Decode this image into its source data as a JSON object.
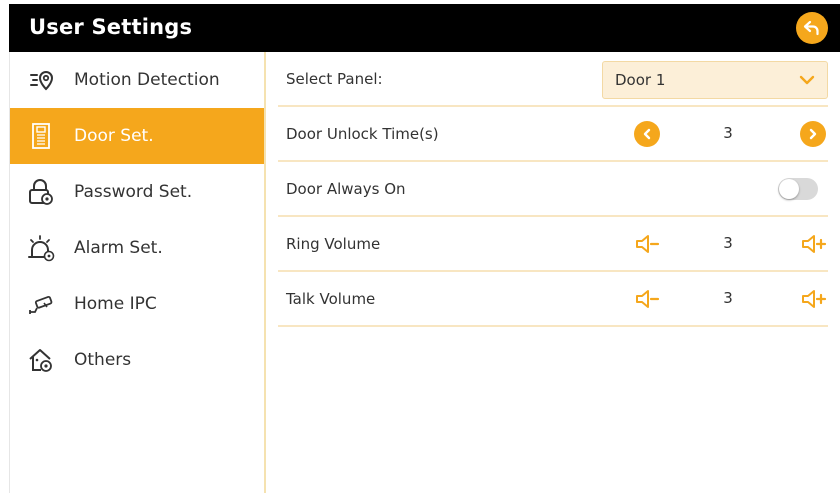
{
  "header": {
    "title": "User Settings",
    "back_icon": "back-arrow-icon"
  },
  "colors": {
    "accent": "#F5A71C",
    "header_bg": "#000000",
    "select_bg": "#FCEFD8",
    "divider": "#F8E6C2"
  },
  "sidebar": {
    "items": [
      {
        "label": "Motion Detection",
        "icon": "motion-detection-icon",
        "active": false
      },
      {
        "label": "Door Set.",
        "icon": "door-icon",
        "active": true
      },
      {
        "label": "Password Set.",
        "icon": "password-lock-icon",
        "active": false
      },
      {
        "label": "Alarm Set.",
        "icon": "alarm-icon",
        "active": false
      },
      {
        "label": "Home IPC",
        "icon": "camera-icon",
        "active": false
      },
      {
        "label": "Others",
        "icon": "home-gear-icon",
        "active": false
      }
    ]
  },
  "main": {
    "select_panel": {
      "label": "Select Panel:",
      "value": "Door 1"
    },
    "door_unlock_time": {
      "label": "Door Unlock Time(s)",
      "value": "3"
    },
    "door_always_on": {
      "label": "Door Always On",
      "enabled": false
    },
    "ring_volume": {
      "label": "Ring Volume",
      "value": "3"
    },
    "talk_volume": {
      "label": "Talk Volume",
      "value": "3"
    }
  }
}
